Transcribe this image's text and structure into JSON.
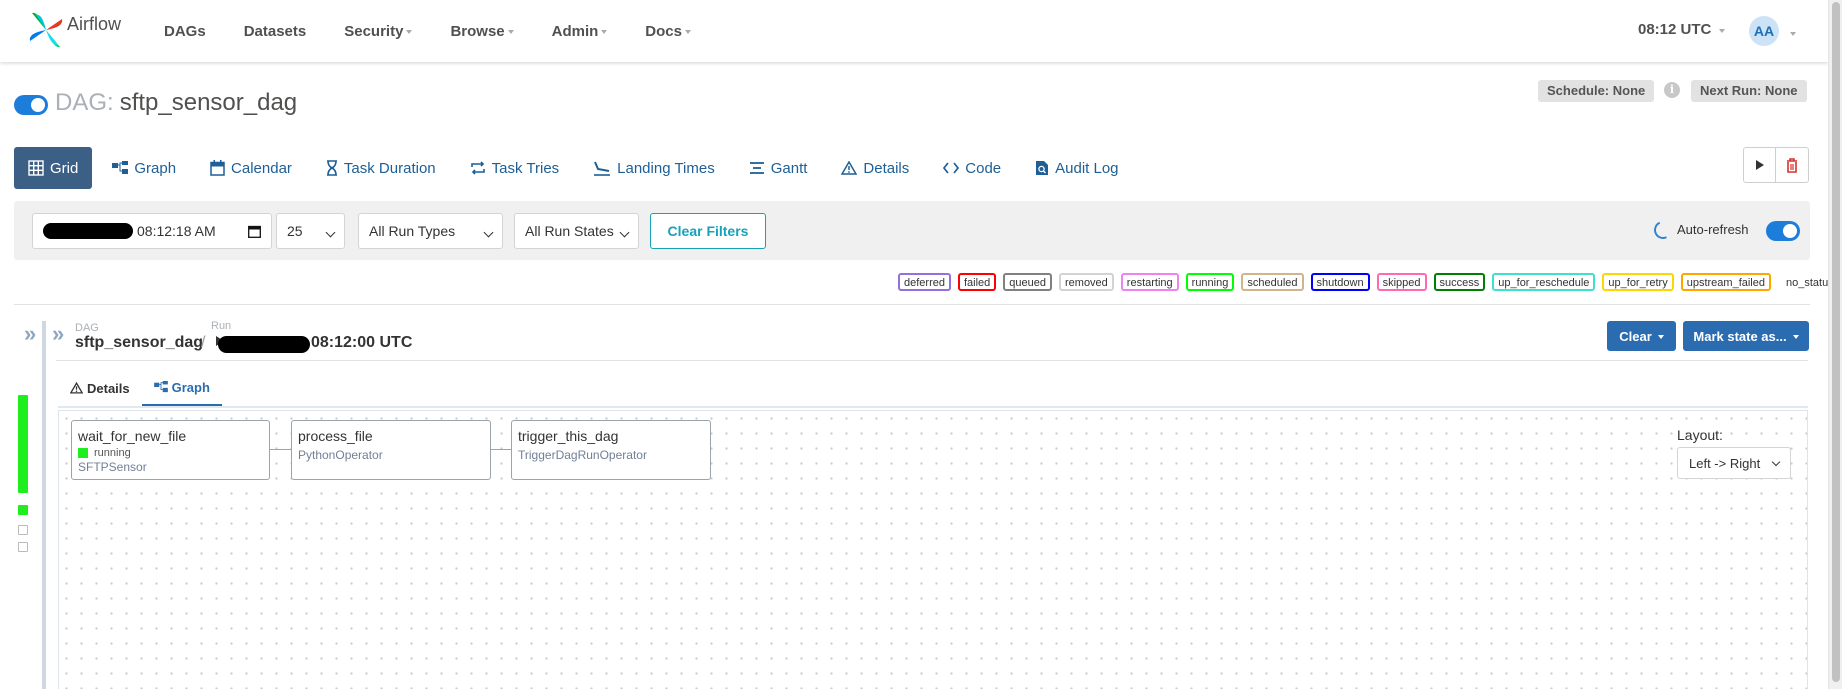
{
  "navbar": {
    "brand": "Airflow",
    "items": [
      {
        "label": "DAGs",
        "dropdown": false
      },
      {
        "label": "Datasets",
        "dropdown": false
      },
      {
        "label": "Security",
        "dropdown": true
      },
      {
        "label": "Browse",
        "dropdown": true
      },
      {
        "label": "Admin",
        "dropdown": true
      },
      {
        "label": "Docs",
        "dropdown": true
      }
    ],
    "time": "08:12 UTC",
    "avatar": "AA"
  },
  "dag": {
    "prefix": "DAG:",
    "name": "sftp_sensor_dag",
    "schedule": "Schedule: None",
    "next_run": "Next Run: None",
    "paused": false
  },
  "tabs": [
    {
      "label": "Grid",
      "icon": "grid-icon"
    },
    {
      "label": "Graph",
      "icon": "graph-icon"
    },
    {
      "label": "Calendar",
      "icon": "calendar-icon"
    },
    {
      "label": "Task Duration",
      "icon": "hourglass-icon"
    },
    {
      "label": "Task Tries",
      "icon": "repeat-icon"
    },
    {
      "label": "Landing Times",
      "icon": "landing-icon"
    },
    {
      "label": "Gantt",
      "icon": "gantt-icon"
    },
    {
      "label": "Details",
      "icon": "warning-icon"
    },
    {
      "label": "Code",
      "icon": "code-icon"
    },
    {
      "label": "Audit Log",
      "icon": "audit-log-icon"
    }
  ],
  "filters": {
    "date_time": "08:12:18 AM",
    "num_runs": "25",
    "run_types": "All Run Types",
    "run_states": "All Run States",
    "clear_label": "Clear Filters",
    "auto_refresh_label": "Auto-refresh",
    "auto_refresh_on": true
  },
  "legend": [
    {
      "label": "deferred",
      "color": "#9370db"
    },
    {
      "label": "failed",
      "color": "#ff0000"
    },
    {
      "label": "queued",
      "color": "#808080"
    },
    {
      "label": "removed",
      "color": "#d3d3d3"
    },
    {
      "label": "restarting",
      "color": "#ee82ee"
    },
    {
      "label": "running",
      "color": "#00ff00"
    },
    {
      "label": "scheduled",
      "color": "#d2b48c"
    },
    {
      "label": "shutdown",
      "color": "#0000ff"
    },
    {
      "label": "skipped",
      "color": "#ff69b4"
    },
    {
      "label": "success",
      "color": "#008000"
    },
    {
      "label": "up_for_reschedule",
      "color": "#40e0d0"
    },
    {
      "label": "up_for_retry",
      "color": "#ffd700"
    },
    {
      "label": "upstream_failed",
      "color": "#ffa500"
    },
    {
      "label": "no_status",
      "color": null
    }
  ],
  "details": {
    "dag_label": "DAG",
    "dag_name": "sftp_sensor_dag",
    "run_label": "Run",
    "run_time": "08:12:00 UTC",
    "clear_btn": "Clear",
    "mark_state_btn": "Mark state as...",
    "subtabs": [
      {
        "label": "Details",
        "icon": "warning-icon"
      },
      {
        "label": "Graph",
        "icon": "graph-icon"
      }
    ]
  },
  "graph": {
    "nodes": [
      {
        "task_id": "wait_for_new_file",
        "state": "running",
        "operator": "SFTPSensor"
      },
      {
        "task_id": "process_file",
        "state": "",
        "operator": "PythonOperator"
      },
      {
        "task_id": "trigger_this_dag",
        "state": "",
        "operator": "TriggerDagRunOperator"
      }
    ],
    "layout_label": "Layout:",
    "layout_value": "Left -> Right"
  },
  "colors": {
    "accent": "#1d7ddb",
    "tab_active": "#3b5f85",
    "primary_button": "#2b6cb0",
    "running": "#1eed1e"
  }
}
